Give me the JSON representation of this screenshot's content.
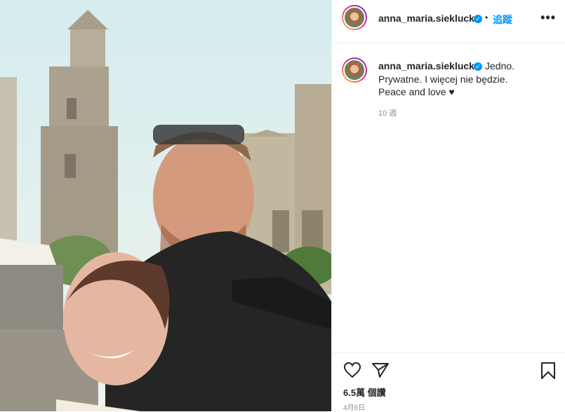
{
  "post": {
    "username": "anna_maria.sieklucka",
    "follow_label": "追蹤",
    "separator": "•",
    "more_label": "•••",
    "caption_lines": [
      "Jedno.",
      "Prywatne. I więcej nie będzie.",
      "Peace and love ♥"
    ],
    "time_ago": "10 週",
    "views": "6.5萬 個讚",
    "date": "4月6日"
  },
  "icons": {
    "verified": "verified-badge-icon",
    "like": "heart-icon",
    "share": "paper-plane-icon",
    "save": "bookmark-icon"
  },
  "colors": {
    "link": "#0095f6",
    "text": "#262626",
    "muted": "#8e8e8e",
    "border": "#efefef"
  }
}
